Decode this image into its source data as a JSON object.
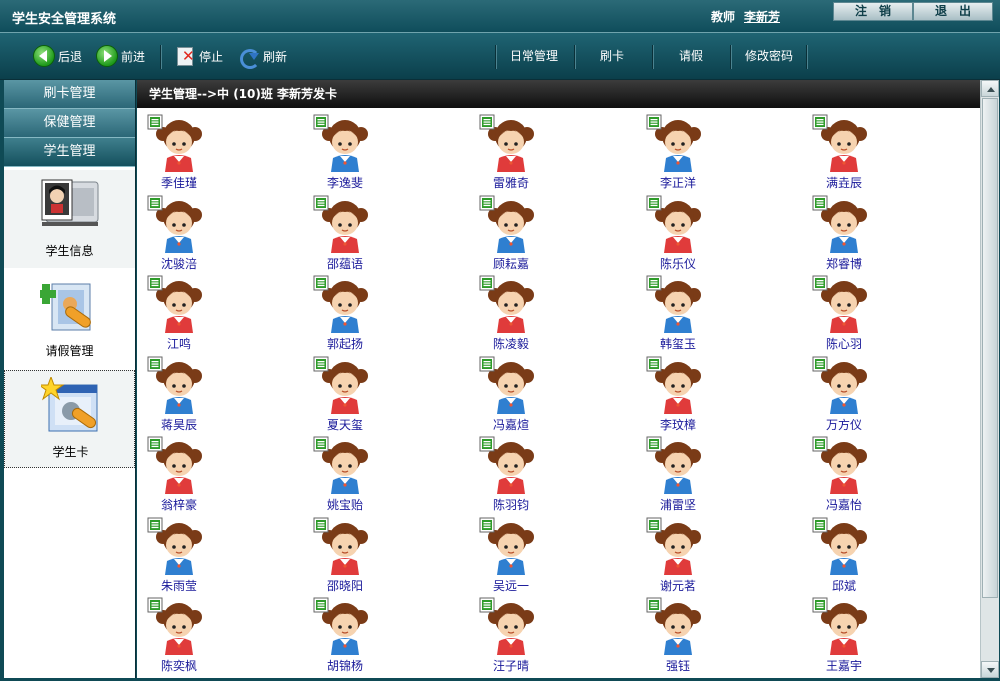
{
  "app": {
    "title": "学生安全管理系统"
  },
  "header": {
    "teacher_label": "教师",
    "teacher_name": "李新芳",
    "logout_label": "注销",
    "exit_label": "退出"
  },
  "toolbar": {
    "back_label": "后退",
    "forward_label": "前进",
    "stop_label": "停止",
    "refresh_label": "刷新",
    "nav": [
      "日常管理",
      "刷卡",
      "请假",
      "修改密码"
    ]
  },
  "sidebar": {
    "tabs": [
      {
        "label": "刷卡管理",
        "active": false
      },
      {
        "label": "保健管理",
        "active": false
      },
      {
        "label": "学生管理",
        "active": true
      }
    ],
    "items": [
      {
        "label": "学生信息",
        "icon": "student-info-icon"
      },
      {
        "label": "请假管理",
        "icon": "leave-management-icon"
      },
      {
        "label": "学生卡",
        "icon": "student-card-icon"
      }
    ]
  },
  "main": {
    "breadcrumb": "学生管理-->中 (10)班  李新芳发卡",
    "students": [
      [
        "季佳瑾",
        "李逸斐",
        "雷雅奇",
        "李正洋",
        "满垚辰"
      ],
      [
        "沈骏涪",
        "邵蕴语",
        "顾耘嘉",
        "陈乐仪",
        "郑睿博"
      ],
      [
        "江鸣",
        "郭起扬",
        "陈凌毅",
        "韩玺玉",
        "陈心羽"
      ],
      [
        "蒋昊辰",
        "夏天玺",
        "冯嘉煊",
        "李玟樟",
        "万方仪"
      ],
      [
        "翁梓豪",
        "姚宝贻",
        "陈羽钧",
        "浦雷坚",
        "冯嘉怡"
      ],
      [
        "朱雨莹",
        "邵晓阳",
        "吴远一",
        "谢元茗",
        "邱斌"
      ],
      [
        "陈奕枫",
        "胡锦杨",
        "汪子晴",
        "强钰",
        "王嘉宇"
      ]
    ]
  },
  "colors": {
    "frame": "#0f4a55",
    "student_name": "#1a1a9a",
    "shirt_girl": "#e03b3b",
    "shirt_boy": "#2f7fd0",
    "hair": "#7a3b17"
  }
}
